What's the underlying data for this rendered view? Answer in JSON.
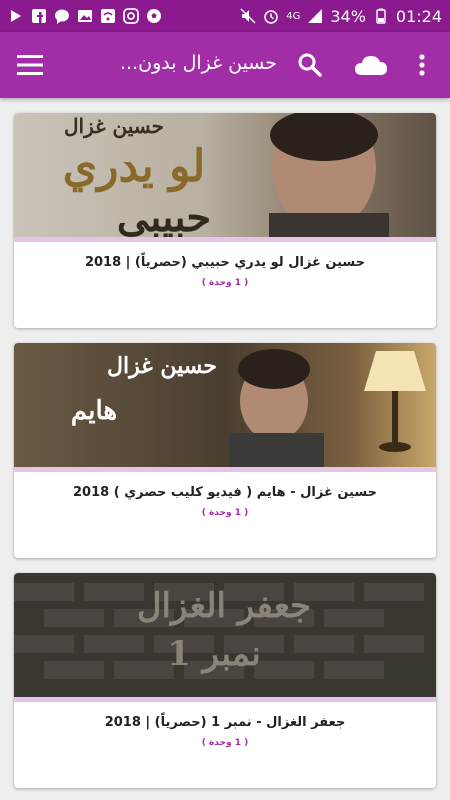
{
  "status_bar": {
    "battery": "34%",
    "time": "01:24",
    "network": "4G"
  },
  "app_bar": {
    "title": "حسين غزال بدون...",
    "menu_icon": "hamburger-menu-icon",
    "search_icon": "search-icon",
    "cloud_icon": "cloud-icon",
    "more_icon": "more-vert-icon"
  },
  "colors": {
    "status_bar": "#8a1a8e",
    "app_bar": "#a22ea7",
    "accent": "#a22ea7",
    "card_divider": "#e6c3e8"
  },
  "cards": [
    {
      "title": "حسين غزال لو يدري حبيبي (حصرياً) | 2018",
      "subtitle": "( 1 وحدة )",
      "image_text": [
        "حسين غزال",
        "لو يدري",
        "حبيبي"
      ]
    },
    {
      "title": "حسين غزال - هايم ( فيديو كليب حصري ) 2018",
      "subtitle": "( 1 وحدة )",
      "image_text": [
        "حسين غزال",
        "هايم"
      ]
    },
    {
      "title": "جعفر الغزال - نمبر 1 (حصرياً) | 2018",
      "subtitle": "( 1 وحدة )",
      "image_text": [
        "جعفر الغزال",
        "نمبر 1"
      ]
    }
  ]
}
